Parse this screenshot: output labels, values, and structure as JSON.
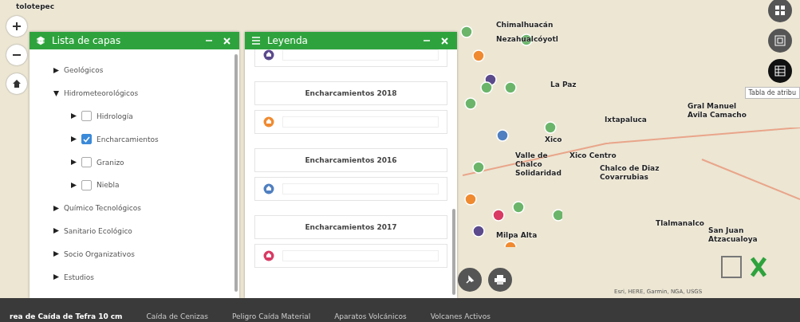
{
  "map": {
    "labels": [
      {
        "text": "tolotepec"
      },
      {
        "text": "Chimalhuacán"
      },
      {
        "text": "Nezahualcóyotl"
      },
      {
        "text": "La Paz"
      },
      {
        "text": "Gral Manuel Avila Camacho"
      },
      {
        "text": "Ixtapaluca"
      },
      {
        "text": "Xico"
      },
      {
        "text": "Valle de Chalco Solidaridad"
      },
      {
        "text": "Xico Centro"
      },
      {
        "text": "Chalco de Diaz Covarrubias"
      },
      {
        "text": "Tlalmanalco"
      },
      {
        "text": "Milpa Alta"
      },
      {
        "text": "San Juan Atzacualoya"
      }
    ],
    "attribution": "Esri, HERE, Garmin, NGA, USGS",
    "tooltip": "Tabla de atribu"
  },
  "layers_panel": {
    "title": "Lista de capas",
    "items": [
      {
        "label": "Geológicos",
        "expanded": false
      },
      {
        "label": "Hidrometeorológicos",
        "expanded": true,
        "children": [
          {
            "label": "Hidrología",
            "checked": false
          },
          {
            "label": "Encharcamientos",
            "checked": true
          },
          {
            "label": "Granizo",
            "checked": false
          },
          {
            "label": "Niebla",
            "checked": false
          }
        ]
      },
      {
        "label": "Químico Tecnológicos",
        "expanded": false
      },
      {
        "label": "Sanitario Ecológico",
        "expanded": false
      },
      {
        "label": "Socio Organizativos",
        "expanded": false
      },
      {
        "label": "Estudios",
        "expanded": false
      }
    ]
  },
  "legend_panel": {
    "title": "Leyenda",
    "entries": [
      {
        "kind": "symbol",
        "color": "#5b4a8c"
      },
      {
        "kind": "title",
        "text": "Encharcamientos 2018"
      },
      {
        "kind": "symbol",
        "color": "#f08a30"
      },
      {
        "kind": "title",
        "text": "Encharcamientos 2016"
      },
      {
        "kind": "symbol",
        "color": "#4f7fc0"
      },
      {
        "kind": "title",
        "text": "Encharcamientos 2017"
      },
      {
        "kind": "symbol",
        "color": "#d83a63"
      }
    ]
  },
  "map_tools": [
    {
      "kind": "grid",
      "selected": false
    },
    {
      "kind": "extent",
      "selected": false
    },
    {
      "kind": "table",
      "selected": true
    }
  ],
  "bottom_tabs": [
    {
      "label": "rea de Caída de Tefra 10 cm",
      "selected": true
    },
    {
      "label": "Caída de Cenizas",
      "selected": false
    },
    {
      "label": "Peligro Caída Material",
      "selected": false
    },
    {
      "label": "Aparatos Volcánicos",
      "selected": false
    },
    {
      "label": "Volcanes Activos",
      "selected": false
    }
  ]
}
